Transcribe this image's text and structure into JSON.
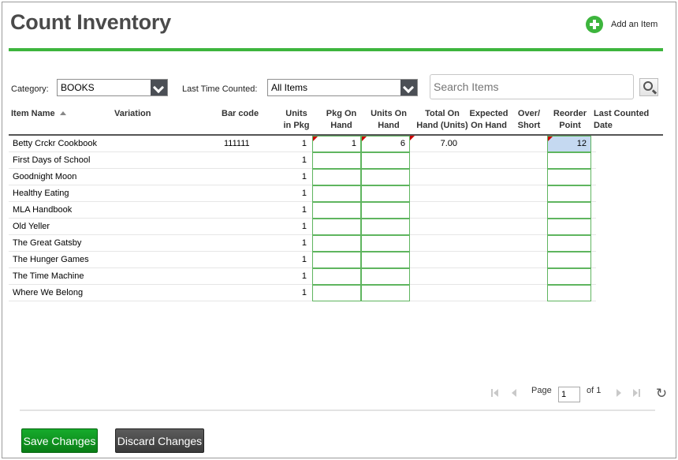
{
  "header": {
    "title": "Count Inventory",
    "add_item_label": "Add an Item",
    "accent_color": "#3db53d"
  },
  "filters": {
    "category_label": "Category:",
    "category_value": "BOOKS",
    "last_counted_label": "Last Time Counted:",
    "last_counted_value": "All Items",
    "search_placeholder": "Search Items"
  },
  "columns": {
    "item_name": "Item Name",
    "variation": "Variation",
    "bar_code": "Bar code",
    "units_in_pkg_1": "Units",
    "units_in_pkg_2": "in Pkg",
    "pkg_on_hand_1": "Pkg On",
    "pkg_on_hand_2": "Hand",
    "units_on_hand_1": "Units On",
    "units_on_hand_2": "Hand",
    "total_on_hand_1": "Total On",
    "total_on_hand_2": "Hand (Units)",
    "expected_on_hand_1": "Expected",
    "expected_on_hand_2": "On Hand",
    "over_short_1": "Over/",
    "over_short_2": "Short",
    "reorder_point_1": "Reorder",
    "reorder_point_2": "Point",
    "last_counted_1": "Last Counted",
    "last_counted_2": "Date"
  },
  "rows": [
    {
      "name": "Betty Crckr Cookbook",
      "barcode": "111111",
      "units_in_pkg": "1",
      "pkg_on_hand": "1",
      "units_on_hand": "6",
      "total": "7.00",
      "reorder": "12"
    },
    {
      "name": "First Days of School",
      "barcode": "",
      "units_in_pkg": "1",
      "pkg_on_hand": "",
      "units_on_hand": "",
      "total": "",
      "reorder": ""
    },
    {
      "name": "Goodnight Moon",
      "barcode": "",
      "units_in_pkg": "1",
      "pkg_on_hand": "",
      "units_on_hand": "",
      "total": "",
      "reorder": ""
    },
    {
      "name": "Healthy Eating",
      "barcode": "",
      "units_in_pkg": "1",
      "pkg_on_hand": "",
      "units_on_hand": "",
      "total": "",
      "reorder": ""
    },
    {
      "name": "MLA Handbook",
      "barcode": "",
      "units_in_pkg": "1",
      "pkg_on_hand": "",
      "units_on_hand": "",
      "total": "",
      "reorder": ""
    },
    {
      "name": "Old Yeller",
      "barcode": "",
      "units_in_pkg": "1",
      "pkg_on_hand": "",
      "units_on_hand": "",
      "total": "",
      "reorder": ""
    },
    {
      "name": "The Great Gatsby",
      "barcode": "",
      "units_in_pkg": "1",
      "pkg_on_hand": "",
      "units_on_hand": "",
      "total": "",
      "reorder": ""
    },
    {
      "name": "The Hunger Games",
      "barcode": "",
      "units_in_pkg": "1",
      "pkg_on_hand": "",
      "units_on_hand": "",
      "total": "",
      "reorder": ""
    },
    {
      "name": "The Time Machine",
      "barcode": "",
      "units_in_pkg": "1",
      "pkg_on_hand": "",
      "units_on_hand": "",
      "total": "",
      "reorder": ""
    },
    {
      "name": "Where We Belong",
      "barcode": "",
      "units_in_pkg": "1",
      "pkg_on_hand": "",
      "units_on_hand": "",
      "total": "",
      "reorder": ""
    }
  ],
  "pager": {
    "page_label": "Page",
    "page_value": "1",
    "of_label": "of 1"
  },
  "footer": {
    "save_label": "Save Changes",
    "discard_label": "Discard Changes",
    "save_color": "#0a8a1a",
    "discard_color": "#444444"
  }
}
